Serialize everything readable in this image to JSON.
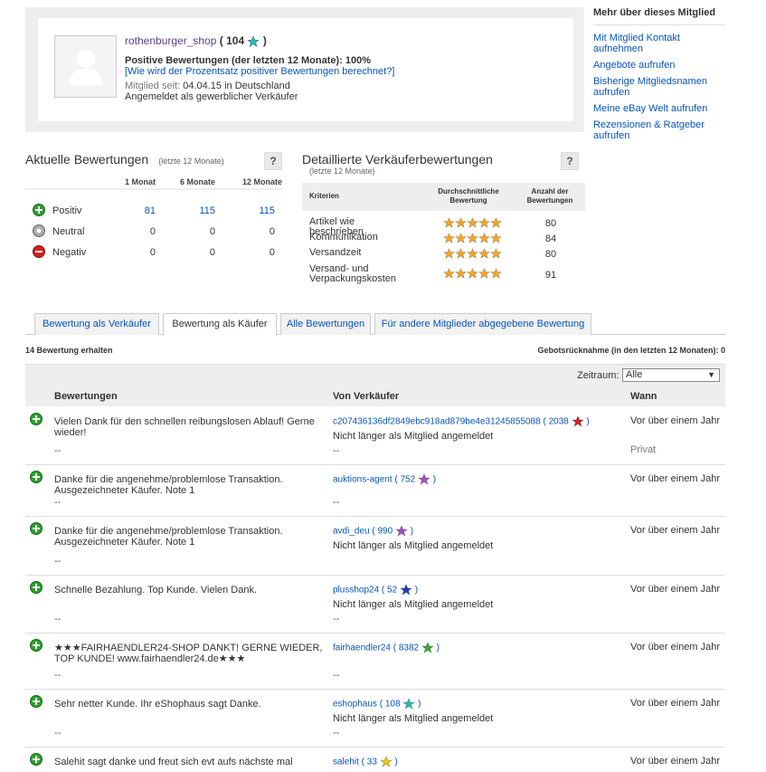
{
  "profile": {
    "username": "rothenburger_shop",
    "score": "104",
    "positive_text": "Positive Bewertungen (der letzten 12 Monate): 100%",
    "percent_link": "[Wie wird der Prozentsatz positiver Bewertungen berechnet?]",
    "member_since_label": "Mitglied seit:",
    "member_since_value": "04.04.15 in Deutschland",
    "seller_type": "Angemeldet als gewerblicher Verkäufer"
  },
  "sidebar": {
    "title": "Mehr über dieses Mitglied",
    "links": [
      "Mit Mitglied Kontakt aufnehmen",
      "Angebote aufrufen",
      "Bisherige Mitgliedsnamen aufrufen",
      "Meine eBay Welt aufrufen",
      "Rezensionen & Ratgeber aufrufen"
    ]
  },
  "recent": {
    "title": "Aktuelle Bewertungen",
    "subtitle": "(letzte 12 Monate)",
    "help": "?",
    "columns": [
      "1 Monat",
      "6 Monate",
      "12 Monate"
    ],
    "rows": [
      {
        "label": "Positiv",
        "values": [
          "81",
          "115",
          "115"
        ],
        "color": "#2e9e2e"
      },
      {
        "label": "Neutral",
        "values": [
          "0",
          "0",
          "0"
        ],
        "color": "#9a9a9a"
      },
      {
        "label": "Negativ",
        "values": [
          "0",
          "0",
          "0"
        ],
        "color": "#d42020"
      }
    ]
  },
  "detail": {
    "title": "Detaillierte Verkäuferbewertungen",
    "subtitle": "(letzte 12 Monate)",
    "help": "?",
    "col_criteria": "Kriterien",
    "col_avg": "Durchschnittliche Bewertung",
    "col_count": "Anzahl der Bewertungen",
    "rows": [
      {
        "criterion": "Artikel wie beschrieben",
        "rating": 5,
        "count": "80"
      },
      {
        "criterion": "Kommunikation",
        "rating": 5,
        "count": "84"
      },
      {
        "criterion": "Versandzeit",
        "rating": 5,
        "count": "80"
      },
      {
        "criterion": "Versand- und Verpackungskosten",
        "rating": 5,
        "count": "91"
      }
    ]
  },
  "tabs": [
    {
      "label": "Bewertung als Verkäufer",
      "active": false
    },
    {
      "label": "Bewertung als Käufer",
      "active": true
    },
    {
      "label": "Alle Bewertungen",
      "active": false
    },
    {
      "label": "Für andere Mitglieder abgegebene Bewertung",
      "active": false
    }
  ],
  "info": {
    "received": "14 Bewertung erhalten",
    "retractions": "Gebotsrücknahme (in den letzten 12 Monaten): 0"
  },
  "filter": {
    "label": "Zeitraum:",
    "selected": "Alle"
  },
  "table": {
    "headers": [
      "Bewertungen",
      "Von Verkäufer",
      "Wann"
    ],
    "rows": [
      {
        "comment": "Vielen Dank für den schnellen reibungslosen Ablauf! Gerne wieder!",
        "seller": "c207436136df2849ebc918ad879be4e31245855088",
        "score": "2038",
        "star": "#d42020",
        "not_member": "Nicht länger als Mitglied angemeldet",
        "when": "Vor über einem Jahr",
        "private": "Privat",
        "dash1": "--",
        "dash2": "--"
      },
      {
        "comment": "Danke für die angenehme/problemlose Transaktion. Ausgezeichneter Käufer. Note 1",
        "seller": "auktions-agent",
        "score": "752",
        "star": "#a050c8",
        "not_member": "",
        "when": "Vor über einem Jahr",
        "private": "",
        "dash1": "--",
        "dash2": "--"
      },
      {
        "comment": "Danke für die angenehme/problemlose Transaktion. Ausgezeichneter Käufer. Note 1",
        "seller": "avdi_deu",
        "score": "990",
        "star": "#a050c8",
        "not_member": "Nicht länger als Mitglied angemeldet",
        "when": "Vor über einem Jahr",
        "private": "",
        "dash1": "--",
        "dash2": ""
      },
      {
        "comment": "Schnelle Bezahlung. Top Kunde. Vielen Dank.",
        "seller": "plusshop24",
        "score": "52",
        "star": "#2040c0",
        "not_member": "Nicht länger als Mitglied angemeldet",
        "when": "Vor über einem Jahr",
        "private": "",
        "dash1": "--",
        "dash2": "--"
      },
      {
        "comment": "★★★FAIRHAENDLER24-SHOP DANKT! GERNE WIEDER, TOP KUNDE! www.fairhaendler24.de★★★",
        "seller": "fairhaendler24",
        "score": "8382",
        "star": "#3aa83a",
        "not_member": "",
        "when": "Vor über einem Jahr",
        "private": "",
        "dash1": "--",
        "dash2": "--"
      },
      {
        "comment": "Sehr netter Kunde. Ihr eShophaus sagt Danke.",
        "seller": "eshophaus",
        "score": "108",
        "star": "#30b8b8",
        "not_member": "Nicht länger als Mitglied angemeldet",
        "when": "Vor über einem Jahr",
        "private": "",
        "dash1": "--",
        "dash2": "--"
      },
      {
        "comment": "Salehit sagt danke und freut sich evt aufs nächste mal",
        "seller": "salehit",
        "score": "33",
        "star": "#e8c820",
        "not_member": "",
        "when": "Vor über einem Jahr",
        "private": "",
        "dash1": "",
        "dash2": ""
      }
    ]
  },
  "colors": {
    "link": "#0654ba",
    "username": "#5c3d8f",
    "star_orange": "#f5a623",
    "score_star": "#30b8b8"
  }
}
